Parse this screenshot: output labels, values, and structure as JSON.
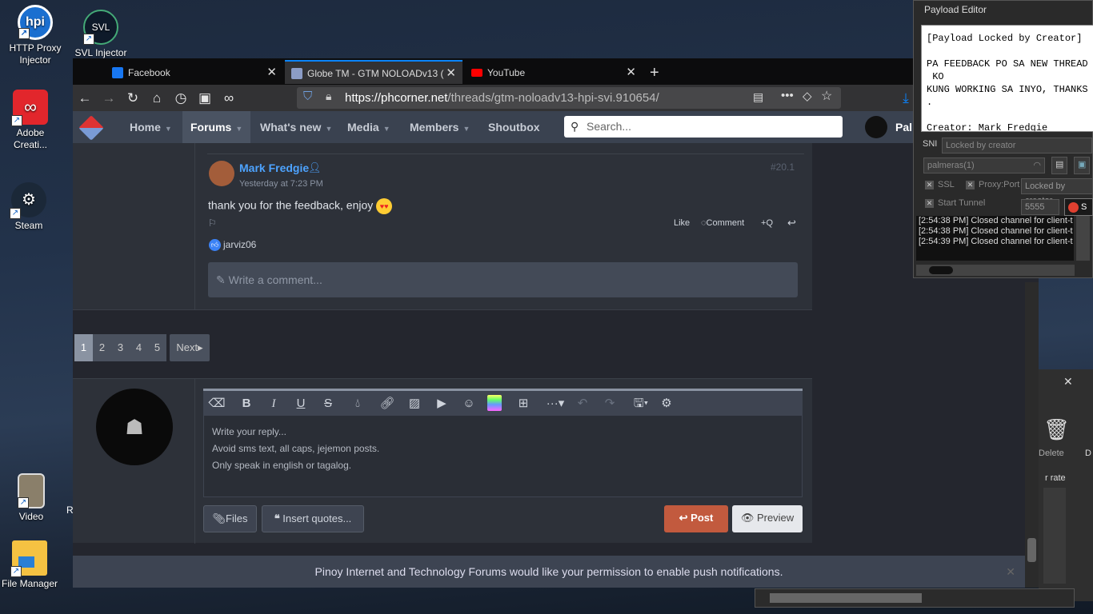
{
  "desktop": {
    "icons": [
      {
        "label": "HTTP Proxy Injector"
      },
      {
        "label": "SVL Injector"
      },
      {
        "label": "Adobe Creati..."
      },
      {
        "label": "Steam"
      },
      {
        "label": "Video"
      },
      {
        "label": "File Manager"
      }
    ],
    "partial_label": "R"
  },
  "browser": {
    "tabs": [
      {
        "label": "Facebook",
        "color": "#1877f2"
      },
      {
        "label": "Globe TM - GTM NOLOADv13 (",
        "color": "#8b9cc6"
      },
      {
        "label": "YouTube",
        "color": "#ff0000"
      }
    ],
    "new_tab": "+",
    "url": {
      "host": "https://phcorner.net",
      "path": "/threads/gtm-noloadv13-hpi-svi.910654/"
    }
  },
  "site": {
    "nav": [
      "Home",
      "Forums",
      "What's new",
      "Media",
      "Members",
      "Shoutbox"
    ],
    "search_placeholder": "Search...",
    "user_initial": "Pal",
    "comment": {
      "author": "Mark Fredgie",
      "time": "Yesterday at 7:23 PM",
      "number": "#20.1",
      "text": "thank you for the feedback, enjoy",
      "actions": {
        "like": "Like",
        "comment": "Comment",
        "quote": "Q"
      },
      "reactor": "jarviz06"
    },
    "write_comment_placeholder": "Write a comment...",
    "pager": {
      "pages": [
        "1",
        "2",
        "3",
        "4",
        "5"
      ],
      "current": "1",
      "next": "Next"
    },
    "editor": {
      "placeholder_lines": [
        "Write your reply...",
        "Avoid sms text, all caps, jejemon posts.",
        "Only speak in english or tagalog."
      ],
      "files": "Files",
      "insert_quotes": "Insert quotes...",
      "post": "Post",
      "preview": "Preview"
    },
    "notification": "Pinoy Internet and Technology Forums would like your permission to enable push notifications."
  },
  "payload_editor": {
    "title": "Payload Editor",
    "text": "[Payload Locked by Creator]\n\nPA FEEDBACK PO SA NEW THREAD\n KO\nKUNG WORKING SA INYO, THANKS\n.\n\nCreator: Mark Fredgie",
    "sni_label": "SNI",
    "sni_value": "Locked by creator",
    "server": "palmeras(1)",
    "ssl": "SSL",
    "proxy_port": "Proxy:Port",
    "proxy_value": "Locked by creator",
    "start_tunnel": "Start Tunnel",
    "port": "5555",
    "log": [
      "[2:54:38 PM] Closed channel for client-t",
      "[2:54:38 PM] Closed channel for client-t",
      "[2:54:39 PM] Closed channel for client-t"
    ]
  },
  "bg_window": {
    "delete": "Delete",
    "d": "D",
    "rate": "r rate",
    "close": "✕"
  }
}
